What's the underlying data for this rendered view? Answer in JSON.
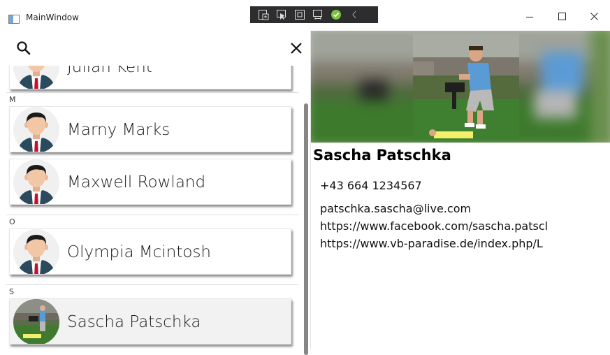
{
  "window": {
    "title": "MainWindow",
    "controls": [
      "minimize-icon",
      "maximize-icon",
      "close-icon"
    ]
  },
  "debug_toolbar": {
    "icons": [
      "live-visual-tree-icon",
      "select-element-icon",
      "display-layout-adorners-icon",
      "track-focused-element-icon",
      "hot-reload-ok-icon",
      "collapse-chevron-icon"
    ],
    "status_color": "#7cc242"
  },
  "search": {
    "icon": "search-icon",
    "clear_icon": "close-icon"
  },
  "contacts": {
    "partial_top_name": "Julian Kent",
    "groups": [
      {
        "letter": "M",
        "items": [
          {
            "name": "Marny Marks"
          },
          {
            "name": "Maxwell Rowland"
          }
        ]
      },
      {
        "letter": "O",
        "items": [
          {
            "name": "Olympia Mcintosh"
          }
        ]
      },
      {
        "letter": "S",
        "items": [
          {
            "name": "Sascha Patschka",
            "selected": true
          }
        ]
      }
    ]
  },
  "detail": {
    "name": "Sascha Patschka",
    "phone": "+43 664 1234567",
    "email": "patschka.sascha@live.com",
    "facebook": "https://www.facebook.com/sascha.patscl",
    "website": "https://www.vb-paradise.de/index.php/L"
  },
  "colors": {
    "avatar_bg": "#f0f0f0",
    "suit": "#2b4a5e",
    "tie": "#c8102e",
    "skin": "#f2c7a5",
    "hair": "#1a1a1a",
    "scroll_thumb": "#868686"
  }
}
